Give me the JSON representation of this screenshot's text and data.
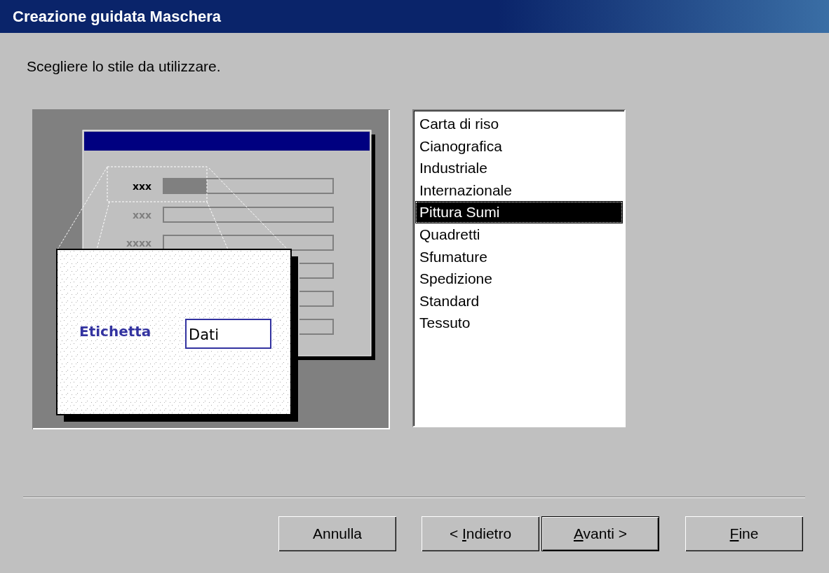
{
  "window": {
    "title": "Creazione guidata Maschera"
  },
  "instruction": "Scegliere lo stile da utilizzare.",
  "preview": {
    "rows": [
      {
        "label": "xxx",
        "highlighted": true
      },
      {
        "label": "xxx",
        "highlighted": false
      },
      {
        "label": "xxxx",
        "highlighted": false
      }
    ],
    "callout": {
      "label": "Etichetta",
      "value": "Dati"
    }
  },
  "styles": [
    {
      "label": "Carta di riso",
      "selected": false
    },
    {
      "label": "Cianografica",
      "selected": false
    },
    {
      "label": "Industriale",
      "selected": false
    },
    {
      "label": "Internazionale",
      "selected": false
    },
    {
      "label": "Pittura Sumi",
      "selected": true
    },
    {
      "label": "Quadretti",
      "selected": false
    },
    {
      "label": "Sfumature",
      "selected": false
    },
    {
      "label": "Spedizione",
      "selected": false
    },
    {
      "label": "Standard",
      "selected": false
    },
    {
      "label": "Tessuto",
      "selected": false
    }
  ],
  "buttons": [
    {
      "before": "Annulla",
      "default": false
    },
    {
      "before": "< ",
      "key": "I",
      "after": "ndietro",
      "default": false
    },
    {
      "key": "A",
      "after": "vanti >",
      "default": true
    },
    {
      "key": "F",
      "after": "ine",
      "default": false
    }
  ]
}
